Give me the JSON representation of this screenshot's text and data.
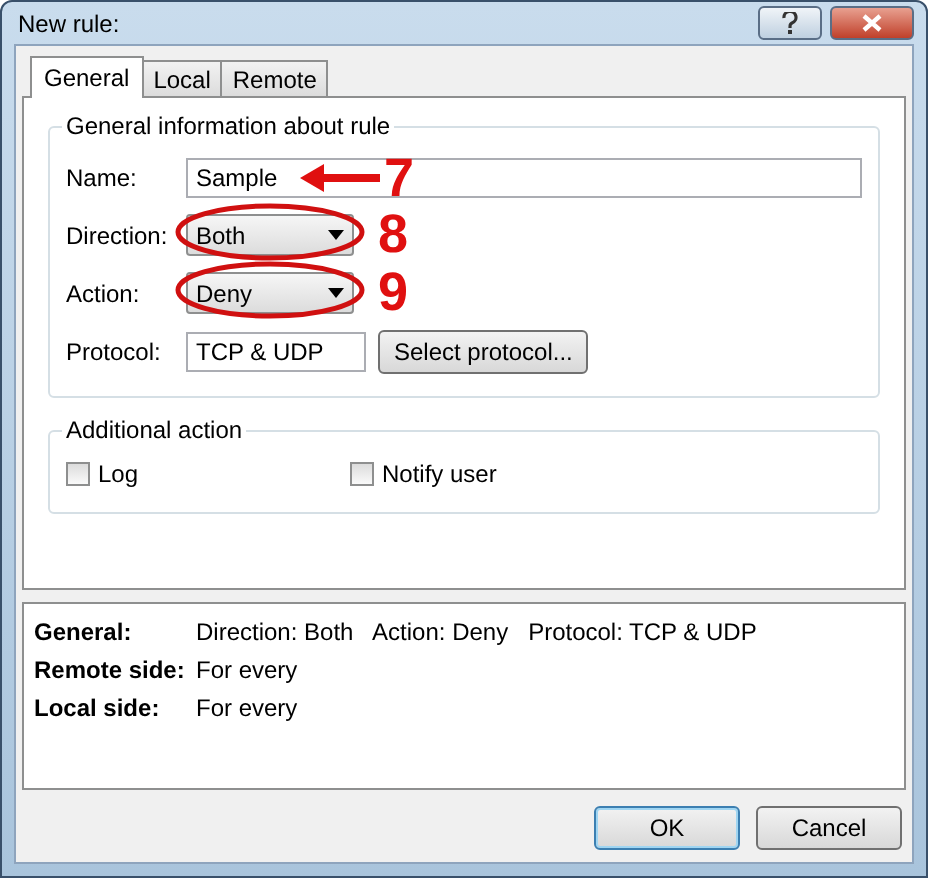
{
  "window": {
    "title": "New rule:"
  },
  "title_buttons": [
    {
      "kind": "help"
    },
    {
      "kind": "close"
    }
  ],
  "tabs": [
    {
      "label": "General",
      "selected": true
    },
    {
      "label": "Local",
      "selected": false
    },
    {
      "label": "Remote",
      "selected": false
    }
  ],
  "general_group": {
    "title": "General information about rule",
    "name": {
      "label": "Name:",
      "value": "Sample",
      "callout": "7"
    },
    "direction": {
      "label": "Direction:",
      "value": "Both",
      "callout": "8"
    },
    "action": {
      "label": "Action:",
      "value": "Deny",
      "callout": "9"
    },
    "protocol": {
      "label": "Protocol:",
      "value": "TCP & UDP",
      "button": "Select protocol..."
    }
  },
  "additional_group": {
    "title": "Additional action",
    "options": [
      {
        "label": "Log",
        "checked": false
      },
      {
        "label": "Notify user",
        "checked": false
      }
    ]
  },
  "summary": [
    {
      "label": "General:",
      "value": "Direction: Both   Action: Deny   Protocol: TCP & UDP"
    },
    {
      "label": "Remote side:",
      "value": "For every"
    },
    {
      "label": "Local side:",
      "value": "For every"
    }
  ],
  "buttons": [
    {
      "label": "OK",
      "default": true
    },
    {
      "label": "Cancel",
      "default": false
    }
  ]
}
